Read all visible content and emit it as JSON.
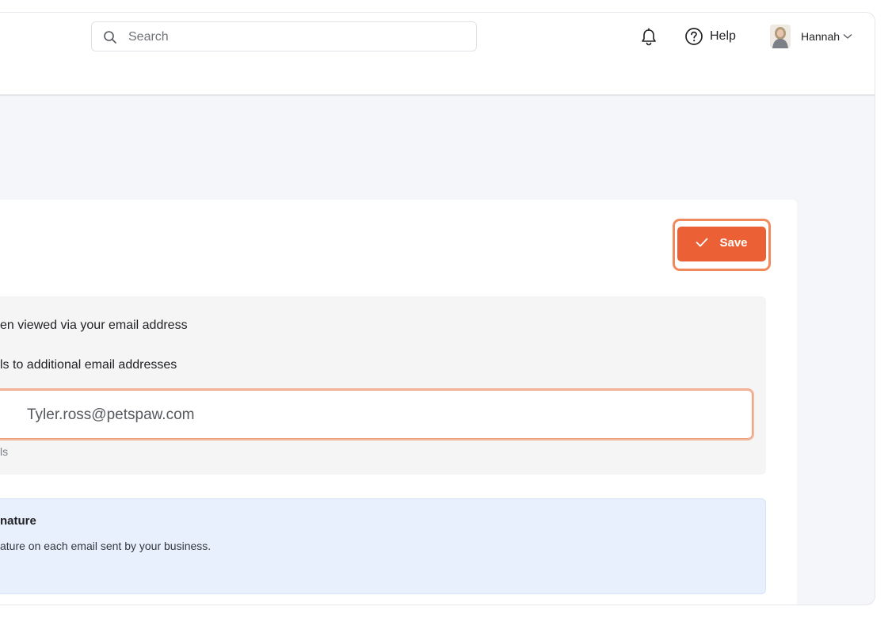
{
  "topbar": {
    "search_placeholder": "Search",
    "help_label": "Help",
    "user_name": "Hannah",
    "icons": [
      "search-icon",
      "bell-icon",
      "help-circle-icon",
      "avatar",
      "chevron-down-icon"
    ]
  },
  "toolbar": {
    "save_label": "Save",
    "save_icon": "check-icon"
  },
  "email_settings": {
    "line1": "en viewed via your email address",
    "line2": "ls to additional email addresses",
    "additional_email_value": "Tyler.ross@petspaw.com",
    "hint": "ls"
  },
  "signature": {
    "title": "nature",
    "description": "ature on each email sent by your business."
  },
  "colors": {
    "accent": "#ec6035",
    "accent_ring": "#f08a5d",
    "signature_bg": "#e8f0fe",
    "section_bg": "#f5f5f6",
    "page_bg": "#f5f6fa"
  }
}
